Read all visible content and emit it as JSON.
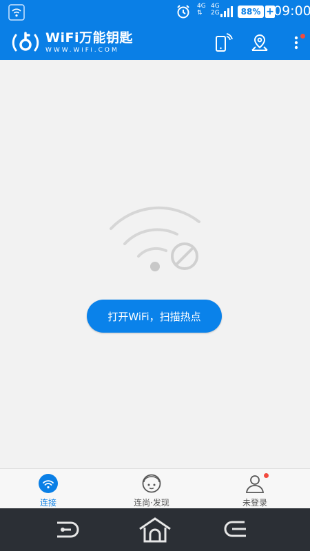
{
  "status_bar": {
    "net_type_top": "4G",
    "net_type_mid_top": "4G",
    "net_type_mid_bottom": "2G",
    "battery": "88%",
    "battery_extra": "+",
    "time": "09:00"
  },
  "app_bar": {
    "brand_name": "WiFi万能钥匙",
    "brand_url": "WWW.WiFi.COM"
  },
  "main": {
    "open_button_label": "打开WiFi，扫描热点"
  },
  "tabs": [
    {
      "label": "连接",
      "icon": "wifi-icon",
      "active": true
    },
    {
      "label": "连尚·发现",
      "icon": "discover-face-icon",
      "active": false
    },
    {
      "label": "未登录",
      "icon": "user-icon",
      "active": false
    }
  ],
  "colors": {
    "primary": "#0a7fe6",
    "badge": "#f24b3f",
    "nav_bg": "#2b2f35"
  }
}
